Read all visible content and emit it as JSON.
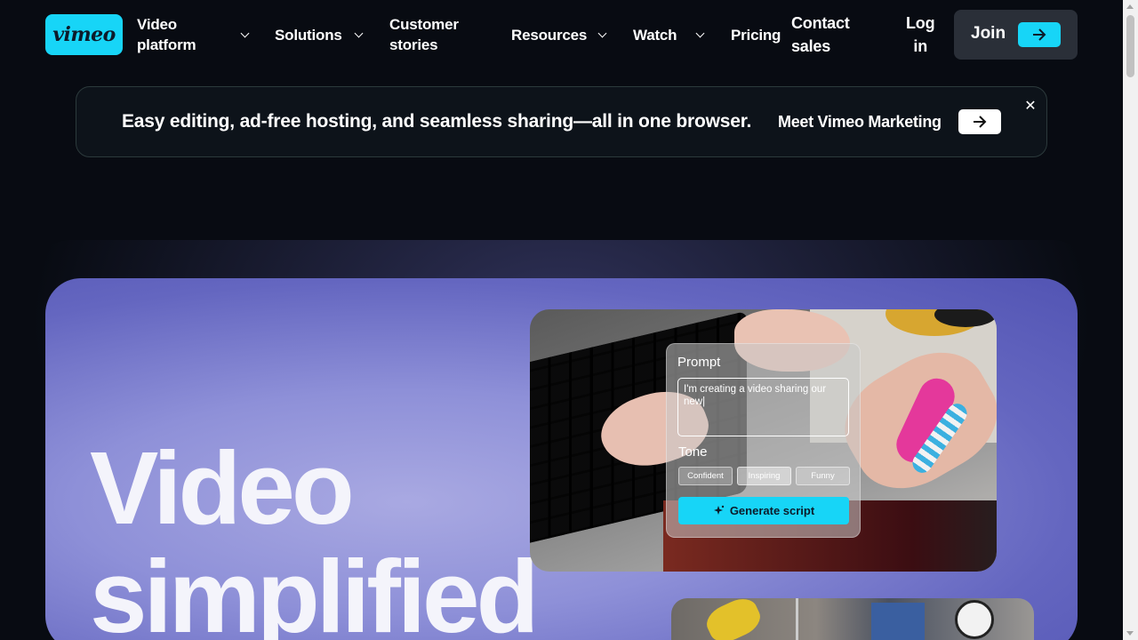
{
  "nav": {
    "logo": "vimeo",
    "items": [
      {
        "label": "Video\nplatform",
        "has_dropdown": true
      },
      {
        "label": "Solutions",
        "has_dropdown": true
      },
      {
        "label": "Customer\nstories",
        "has_dropdown": false
      },
      {
        "label": "Resources",
        "has_dropdown": true
      },
      {
        "label": "Watch",
        "has_dropdown": true
      },
      {
        "label": "Pricing",
        "has_dropdown": false
      },
      {
        "label": "Contact\nsales",
        "has_dropdown": false
      },
      {
        "label": "Log\nin",
        "has_dropdown": false
      }
    ],
    "join_label": "Join"
  },
  "banner": {
    "message": "Easy editing, ad-free hosting, and seamless sharing—all in one browser.",
    "cta_label": "Meet Vimeo Marketing",
    "close_glyph": "✕"
  },
  "hero": {
    "title_line1": "Video",
    "title_line2": "simplified"
  },
  "prompt_card": {
    "title": "Prompt",
    "input_value": "I'm creating a video sharing our new|",
    "tone_label": "Tone",
    "tones": [
      "Confident",
      "Inspiring",
      "Funny"
    ],
    "selected_tone": "Inspiring",
    "generate_label": "Generate script"
  },
  "colors": {
    "accent": "#17d5f7",
    "background": "#080b12",
    "hero_purple": "#8e90d8"
  },
  "icons": {
    "dropdown": "chevron-down-icon",
    "join_arrow": "arrow-right-icon",
    "banner_arrow": "arrow-right-icon",
    "close": "close-icon",
    "sparkle": "sparkle-icon"
  }
}
